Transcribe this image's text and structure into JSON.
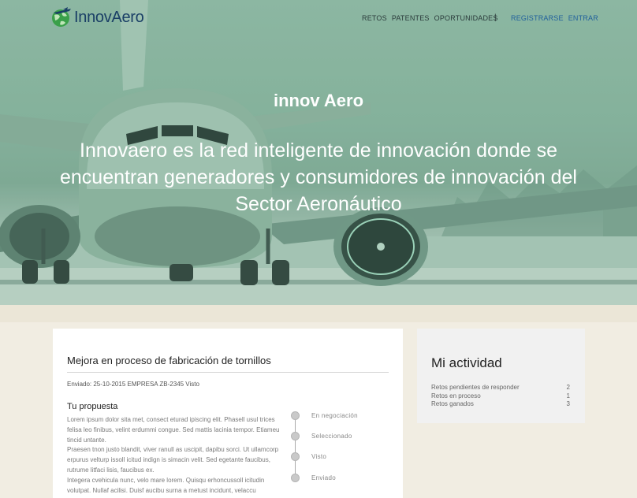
{
  "nav": {
    "logo_text": "InnovAero",
    "links": [
      "RETOS",
      "PATENTES",
      "OPORTUNIDADES"
    ],
    "separator": "|",
    "auth": [
      "REGISTRARSE",
      "ENTRAR"
    ]
  },
  "hero": {
    "title": "innov Aero",
    "subtitle": "Innovaero es la red inteligente de innovación donde se encuentran generadores y consumidores de innovación del Sector Aeronáutico"
  },
  "challenge": {
    "title": "Mejora en proceso de fabricación de tornillos",
    "meta": "Enviado: 25-10-2015 EMPRESA ZB-2345 Visto",
    "proposal_heading": "Tu propuesta",
    "proposal_lines": [
      "Lorem ipsum dolor sita met, consect eturad ipiscing elit. Phasell usul trices felisa leo finibus, velint erdummi congue. Sed mattis lacinia tempor. Etiameu tincid untante.",
      "Praesen tnon justo blandit, viver ranull as uscipit, dapibu sorci. Ut ullamcorp erpurus velturp issoll icitud indign is simacin velit. Sed egetante faucibus, rutrume litfaci lisis, faucibus ex.",
      "Integera cvehicula nunc, velo mare lorem. Quisqu erhoncussoll icitudin volutpat. Nullaf acilisi. Duisf aucibu surna a metust incidunt, velaccu"
    ],
    "timeline": [
      "En negociación",
      "Seleccionado",
      "Visto",
      "Enviado"
    ]
  },
  "activity": {
    "title": "Mi actividad",
    "rows": [
      {
        "label": "Retos pendientes de responder",
        "value": "2"
      },
      {
        "label": "Retos en proceso",
        "value": "1"
      },
      {
        "label": "Retos ganados",
        "value": "3"
      }
    ]
  },
  "colors": {
    "accent": "#1f5f9c",
    "hero_tint": "#86b29d",
    "logo_green": "#3aa04a"
  }
}
